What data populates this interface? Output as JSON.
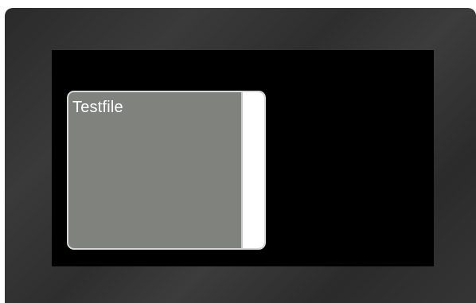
{
  "file_widget": {
    "title": "Testfile"
  },
  "colors": {
    "frame": "#333333",
    "screen": "#000000",
    "widget_fill": "#80827d",
    "widget_border": "#d8d8d8",
    "scrollbar": "#ffffff",
    "title_text": "#ffffff"
  }
}
